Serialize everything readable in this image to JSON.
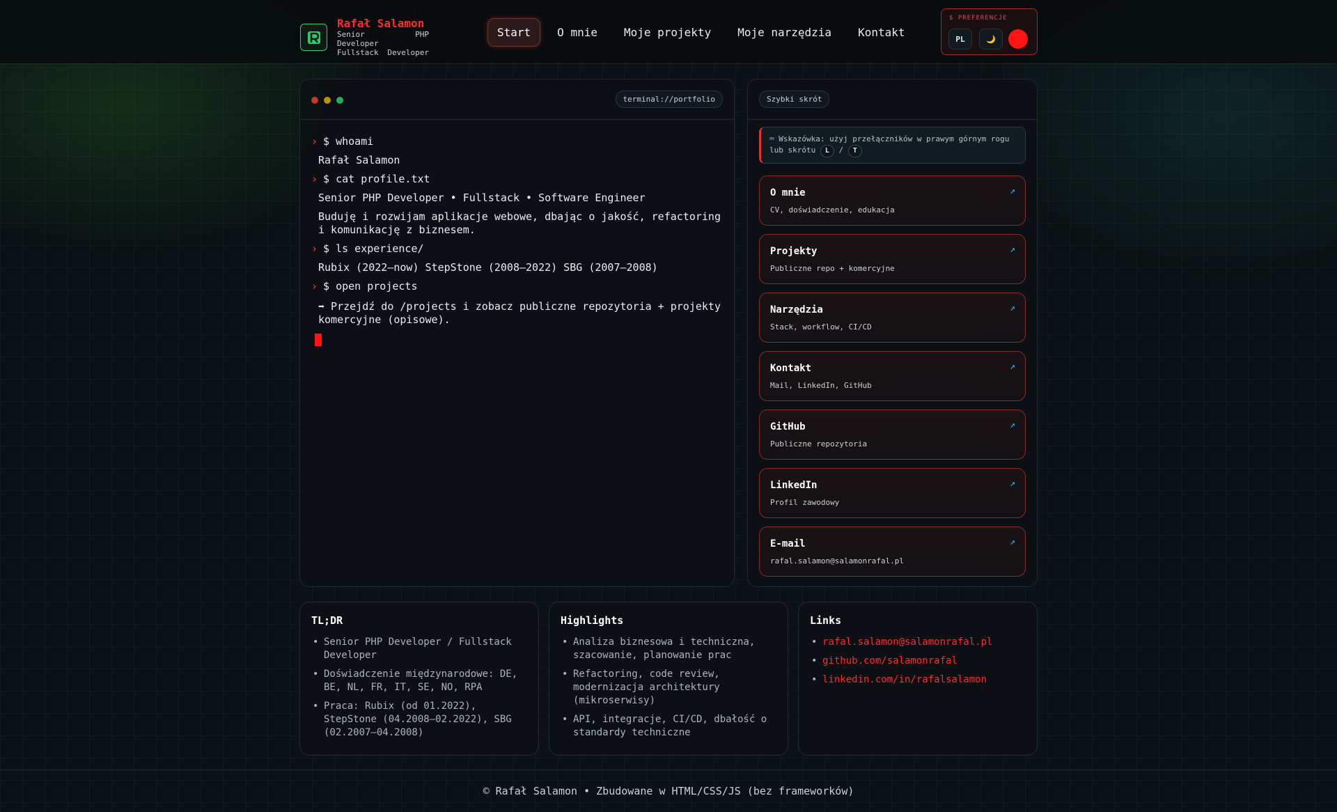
{
  "brand": {
    "name": "Rafał Salamon",
    "line1": "Senior PHP Developer",
    "line2": "Fullstack Developer",
    "accent": "#ff2a2a",
    "logo_color": "#2ecc71"
  },
  "nav": [
    {
      "label": "Start",
      "active": true
    },
    {
      "label": "O mnie"
    },
    {
      "label": "Moje projekty"
    },
    {
      "label": "Moje narzędzia"
    },
    {
      "label": "Kontakt"
    }
  ],
  "preferences": {
    "title": "$ PREFERENCJE",
    "lang": "PL",
    "theme_icon": "moon-icon",
    "theme_glyph": "🌙",
    "color_dot": "#ff1414"
  },
  "terminal": {
    "tag": "terminal://portfolio",
    "lines": [
      {
        "type": "cmd",
        "text": "$ whoami"
      },
      {
        "type": "out",
        "text": "Rafał Salamon"
      },
      {
        "type": "cmd",
        "text": "$ cat profile.txt"
      },
      {
        "type": "out",
        "text": "Senior PHP Developer • Fullstack • Software Engineer"
      },
      {
        "type": "out",
        "text": "Buduję i rozwijam aplikacje webowe, dbając o jakość, refactoring i komunikację z biznesem."
      },
      {
        "type": "cmd",
        "text": "$ ls experience/"
      },
      {
        "type": "out",
        "text": "Rubix (2022–now) StepStone (2008–2022) SBG (2007–2008)"
      },
      {
        "type": "cmd",
        "text": "$ open projects"
      },
      {
        "type": "out",
        "text": "➡ Przejdź do /projects i zobacz publiczne repozytoria + projekty komercyjne (opisowe)."
      }
    ]
  },
  "shortcuts": {
    "tag": "Szybki skrót",
    "hint": {
      "icon": "keyboard-icon",
      "glyph": "⌨",
      "text": "Wskazówka: użyj przełączników w prawym górnym rogu lub skrótu",
      "key1": "L",
      "sep": "/",
      "key2": "T"
    },
    "cards": [
      {
        "title": "O mnie",
        "desc": "CV, doświadczenie, edukacja"
      },
      {
        "title": "Projekty",
        "desc": "Publiczne repo + komercyjne"
      },
      {
        "title": "Narzędzia",
        "desc": "Stack, workflow, CI/CD"
      },
      {
        "title": "Kontakt",
        "desc": "Mail, LinkedIn, GitHub"
      },
      {
        "title": "GitHub",
        "desc": "Publiczne repozytoria"
      },
      {
        "title": "LinkedIn",
        "desc": "Profil zawodowy"
      },
      {
        "title": "E-mail",
        "desc": "rafal.salamon@salamonrafal.pl"
      }
    ],
    "arrow": "↗"
  },
  "panels": {
    "tldr": {
      "title": "TL;DR",
      "items": [
        "Senior PHP Developer / Fullstack Developer",
        "Doświadczenie międzynarodowe: DE, BE, NL, FR, IT, SE, NO, RPA",
        "Praca: Rubix (od 01.2022), StepStone (04.2008–02.2022), SBG (02.2007–04.2008)"
      ]
    },
    "highlights": {
      "title": "Highlights",
      "items": [
        "Analiza biznesowa i techniczna, szacowanie, planowanie prac",
        "Refactoring, code review, modernizacja architektury (mikroserwisy)",
        "API, integracje, CI/CD, dbałość o standardy techniczne"
      ]
    },
    "links": {
      "title": "Links",
      "items": [
        "rafal.salamon@salamonrafal.pl",
        "github.com/salamonrafal",
        "linkedin.com/in/rafalsalamon"
      ]
    }
  },
  "footer": "© Rafał Salamon • Zbudowane w HTML/CSS/JS (bez frameworków)"
}
